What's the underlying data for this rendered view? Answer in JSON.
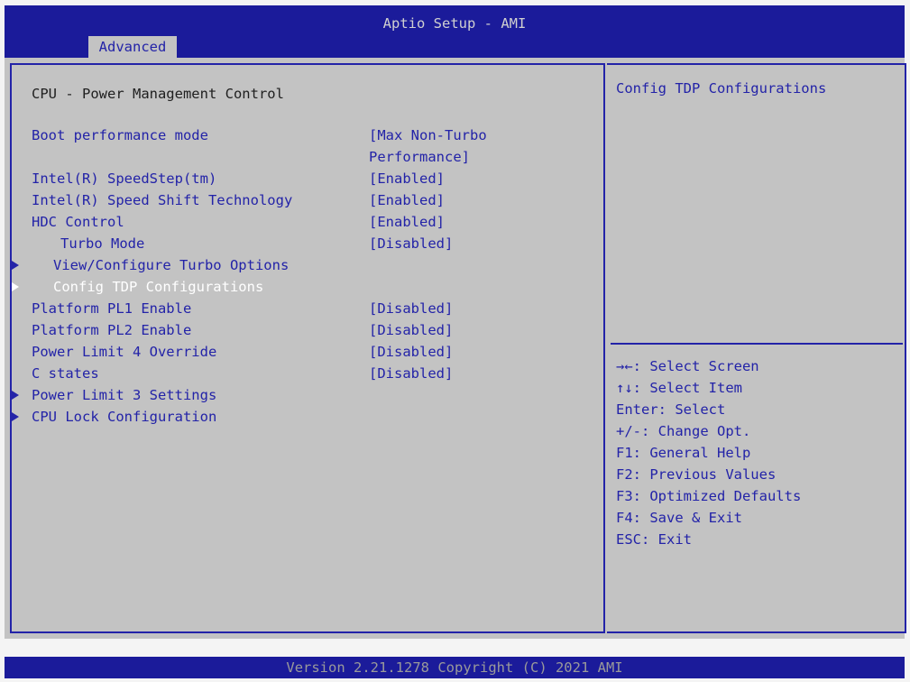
{
  "header": {
    "title": "Aptio Setup - AMI",
    "tab": "Advanced"
  },
  "section_title": "CPU - Power Management Control",
  "items": [
    {
      "label": "Boot performance mode",
      "value_line1": "[Max Non-Turbo",
      "value_line2": "Performance]"
    },
    {
      "label": "Intel(R) SpeedStep(tm)",
      "value": "[Enabled]"
    },
    {
      "label": "Intel(R) Speed Shift Technology",
      "value": "[Enabled]"
    },
    {
      "label": "HDC Control",
      "value": "[Enabled]"
    },
    {
      "label": "Turbo Mode",
      "value": "[Disabled]"
    },
    {
      "label": "View/Configure Turbo Options"
    },
    {
      "label": "Config TDP Configurations"
    },
    {
      "label": "Platform PL1 Enable",
      "value": "[Disabled]"
    },
    {
      "label": "Platform PL2 Enable",
      "value": "[Disabled]"
    },
    {
      "label": "Power Limit 4 Override",
      "value": "[Disabled]"
    },
    {
      "label": "C states",
      "value": "[Disabled]"
    },
    {
      "label": "Power Limit 3 Settings"
    },
    {
      "label": "CPU Lock Configuration"
    }
  ],
  "help": {
    "text": "Config TDP Configurations"
  },
  "keys": [
    "→←: Select Screen",
    "↑↓: Select Item",
    "Enter: Select",
    "+/-: Change Opt.",
    "F1: General Help",
    "F2: Previous Values",
    "F3: Optimized Defaults",
    "F4: Save & Exit",
    "ESC: Exit"
  ],
  "footer": {
    "version": "Version 2.21.1278 Copyright (C) 2021 AMI"
  },
  "colors": {
    "header_bg": "#1b1b9a",
    "panel_bg": "#c3c3c3",
    "accent": "#2323a8",
    "selected_text": "#ffffff"
  }
}
